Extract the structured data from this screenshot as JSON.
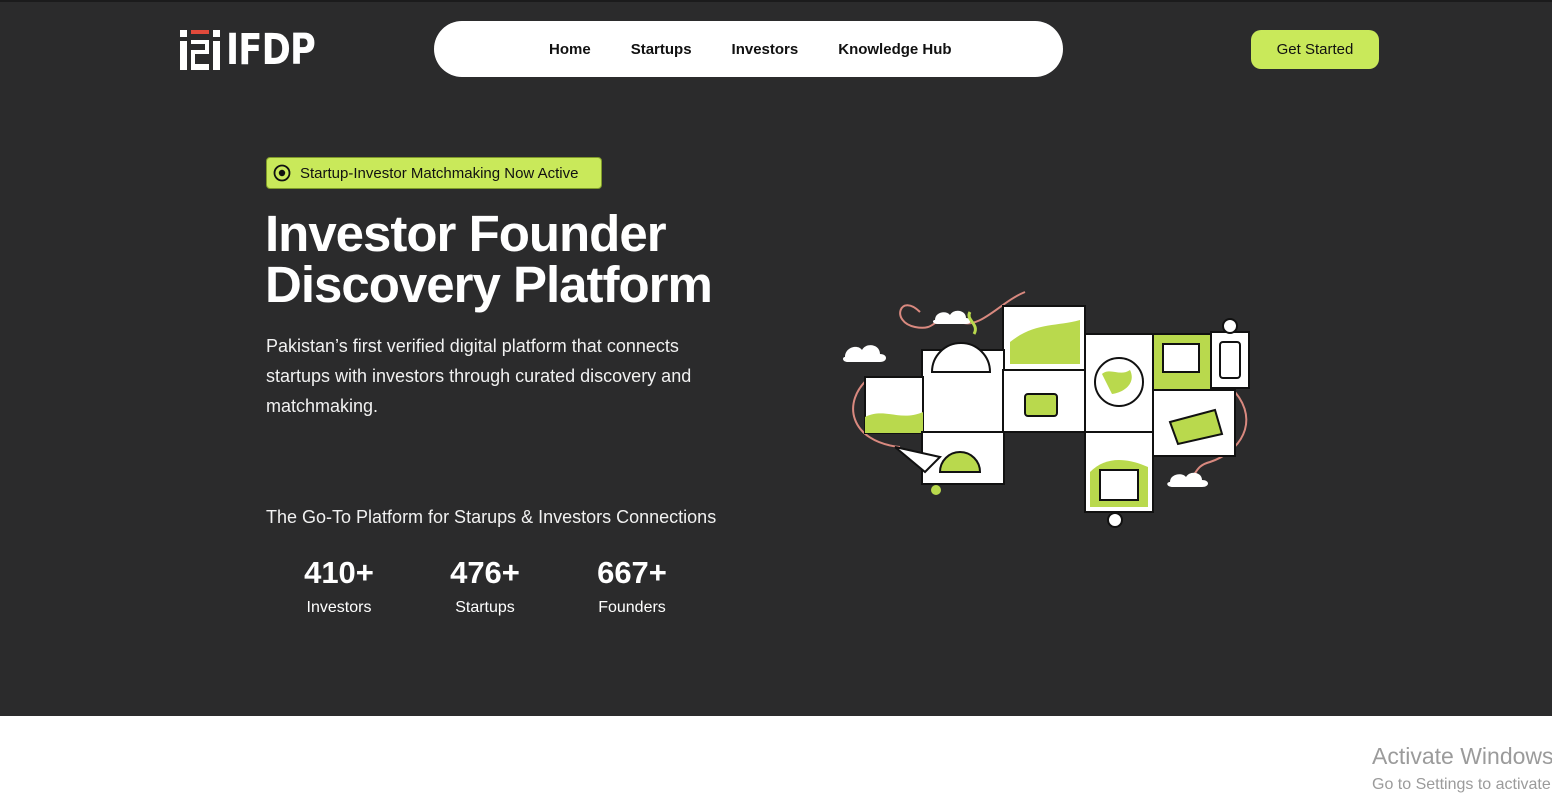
{
  "brand": {
    "name": "IFDP",
    "mark_text": "i2i"
  },
  "nav": {
    "items": [
      "Home",
      "Startups",
      "Investors",
      "Knowledge Hub"
    ]
  },
  "header": {
    "cta_label": "Get Started"
  },
  "hero": {
    "badge": "Startup-Investor Matchmaking Now Active",
    "title_line1": "Investor Founder",
    "title_line2": "Discovery Platform",
    "description": "Pakistan’s first verified digital platform that connects startups with investors through curated discovery and matchmaking.",
    "tagline": "The Go-To Platform for Starups & Investors Connections",
    "stats": [
      {
        "value": "410+",
        "label": "Investors"
      },
      {
        "value": "476+",
        "label": "Startups"
      },
      {
        "value": "667+",
        "label": "Founders"
      }
    ]
  },
  "watermark": {
    "title": "Activate Windows",
    "subtitle": "Go to Settings to activate Windows."
  },
  "colors": {
    "background": "#2b2b2c",
    "accent": "#c9e95a",
    "doodle_line": "#d9897f"
  },
  "icons": [
    "logo-mark-icon",
    "radio-dot-icon"
  ]
}
